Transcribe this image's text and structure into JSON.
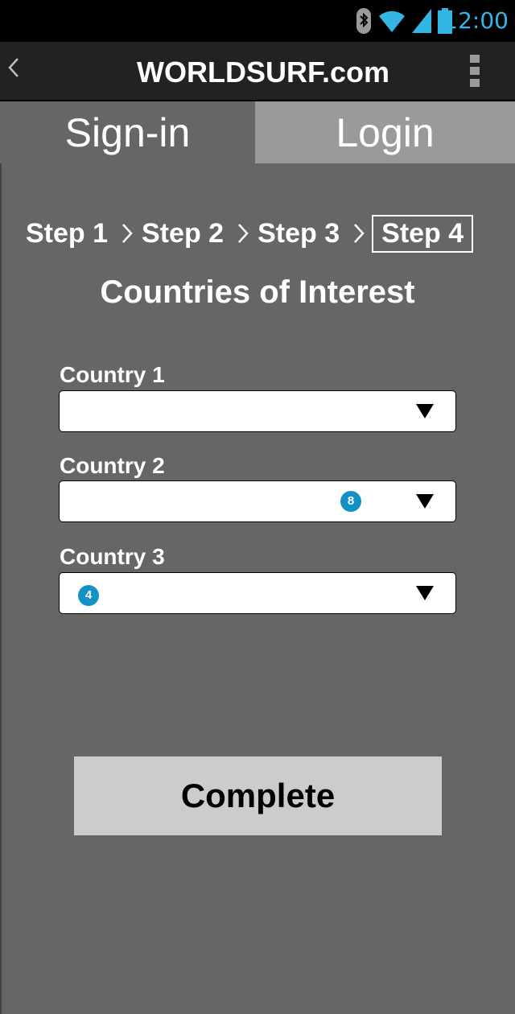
{
  "status_bar": {
    "time": "12:00",
    "icons": [
      "bluetooth-icon",
      "wifi-icon",
      "signal-icon",
      "battery-icon"
    ],
    "accent_color": "#33b5e5"
  },
  "action_bar": {
    "back_icon": "chevron-left-icon",
    "title": "WORLDSURF.com",
    "overflow_icon": "overflow-menu-icon"
  },
  "tabs": [
    {
      "label": "Sign-in",
      "selected": true
    },
    {
      "label": "Login",
      "selected": false
    }
  ],
  "steps": [
    "Step 1",
    "Step 2",
    "Step 3",
    "Step 4"
  ],
  "active_step": "Step 4",
  "heading": "Countries of Interest",
  "fields": [
    {
      "label": "Country 1",
      "value": "",
      "badge": ""
    },
    {
      "label": "Country 2",
      "value": "",
      "badge": "8"
    },
    {
      "label": "Country 3",
      "value": "",
      "badge": "4"
    }
  ],
  "complete_button": "Complete",
  "colors": {
    "background": "#666666",
    "tab_inactive": "#9a9a9a",
    "button": "#cccccc",
    "badge": "#1391c7"
  }
}
